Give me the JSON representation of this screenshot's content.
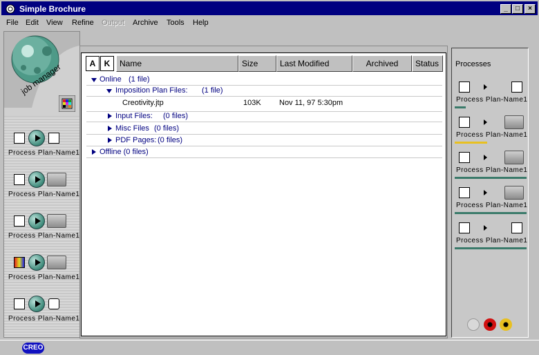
{
  "window": {
    "title": "Simple Brochure",
    "minimize": "_",
    "maximize": "□",
    "close": "×"
  },
  "menu": [
    {
      "label": "File",
      "disabled": false
    },
    {
      "label": "Edit",
      "disabled": false
    },
    {
      "label": "View",
      "disabled": false
    },
    {
      "label": "Refine",
      "disabled": false
    },
    {
      "label": "Output",
      "disabled": true
    },
    {
      "label": "Archive",
      "disabled": false
    },
    {
      "label": "Tools",
      "disabled": false
    },
    {
      "label": "Help",
      "disabled": false
    }
  ],
  "logo": {
    "text": "job manager"
  },
  "left_processes": [
    {
      "label": "Process Plan-Name1",
      "src_icon": "document-stack-icon",
      "dst_icon": "copy-icon"
    },
    {
      "label": "Process Plan-Name1",
      "src_icon": "copy-icon",
      "dst_icon": "output-tray-icon"
    },
    {
      "label": "Process Plan-Name1",
      "src_icon": "grid-icon",
      "dst_icon": "output-tray-icon"
    },
    {
      "label": "Process Plan-Name1",
      "src_icon": "color-grid-icon",
      "dst_icon": "output-tray-icon"
    },
    {
      "label": "Process Plan-Name1",
      "src_icon": "document-stack-icon",
      "dst_icon": "archive-icon"
    }
  ],
  "columns": {
    "a": "A",
    "k": "K",
    "name": "Name",
    "size": "Size",
    "modified": "Last Modified",
    "archived": "Archived",
    "status": "Status"
  },
  "tree": {
    "online": {
      "label": "Online",
      "count": "(1 file)"
    },
    "imposition": {
      "label": "Imposition Plan Files:",
      "count": "(1 file)"
    },
    "file": {
      "name": "Creotivity.jtp",
      "size": "103K",
      "modified": "Nov 11, 97 5:30pm"
    },
    "input": {
      "label": "Input Files:",
      "count": "(0 files)"
    },
    "misc": {
      "label": "Misc Files",
      "count": "(0 files)"
    },
    "pdf": {
      "label": "PDF Pages:",
      "count": "(0 files)"
    },
    "offline": {
      "label": "Offline (0 files)"
    }
  },
  "right_panel": {
    "title": "Processes",
    "items": [
      {
        "label": "Process Plan-Name1",
        "src_icon": "document-stack-icon",
        "dst_icon": "copy-icon",
        "bar_color": "#3a7a6a",
        "bar_fraction": 0.15
      },
      {
        "label": "Process Plan-Name1",
        "src_icon": "copy-icon",
        "dst_icon": "output-tray-icon",
        "bar_color": "#e8c020",
        "bar_fraction": 0.45
      },
      {
        "label": "Process Plan-Name1",
        "src_icon": "grid-icon",
        "dst_icon": "output-tray-icon",
        "bar_color": "#3a7a6a",
        "bar_fraction": 1.0
      },
      {
        "label": "Process Plan-Name1",
        "src_icon": "color-grid-icon",
        "dst_icon": "output-tray-icon",
        "bar_color": "#3a7a6a",
        "bar_fraction": 1.0
      },
      {
        "label": "Process Plan-Name1",
        "src_icon": "document-stack-icon",
        "dst_icon": "archive-icon",
        "bar_color": "#3a7a6a",
        "bar_fraction": 1.0
      }
    ]
  },
  "controls": {
    "stop_color": "#d01010",
    "pause_color": "#e8c020"
  },
  "status": {
    "brand": "CREO"
  }
}
